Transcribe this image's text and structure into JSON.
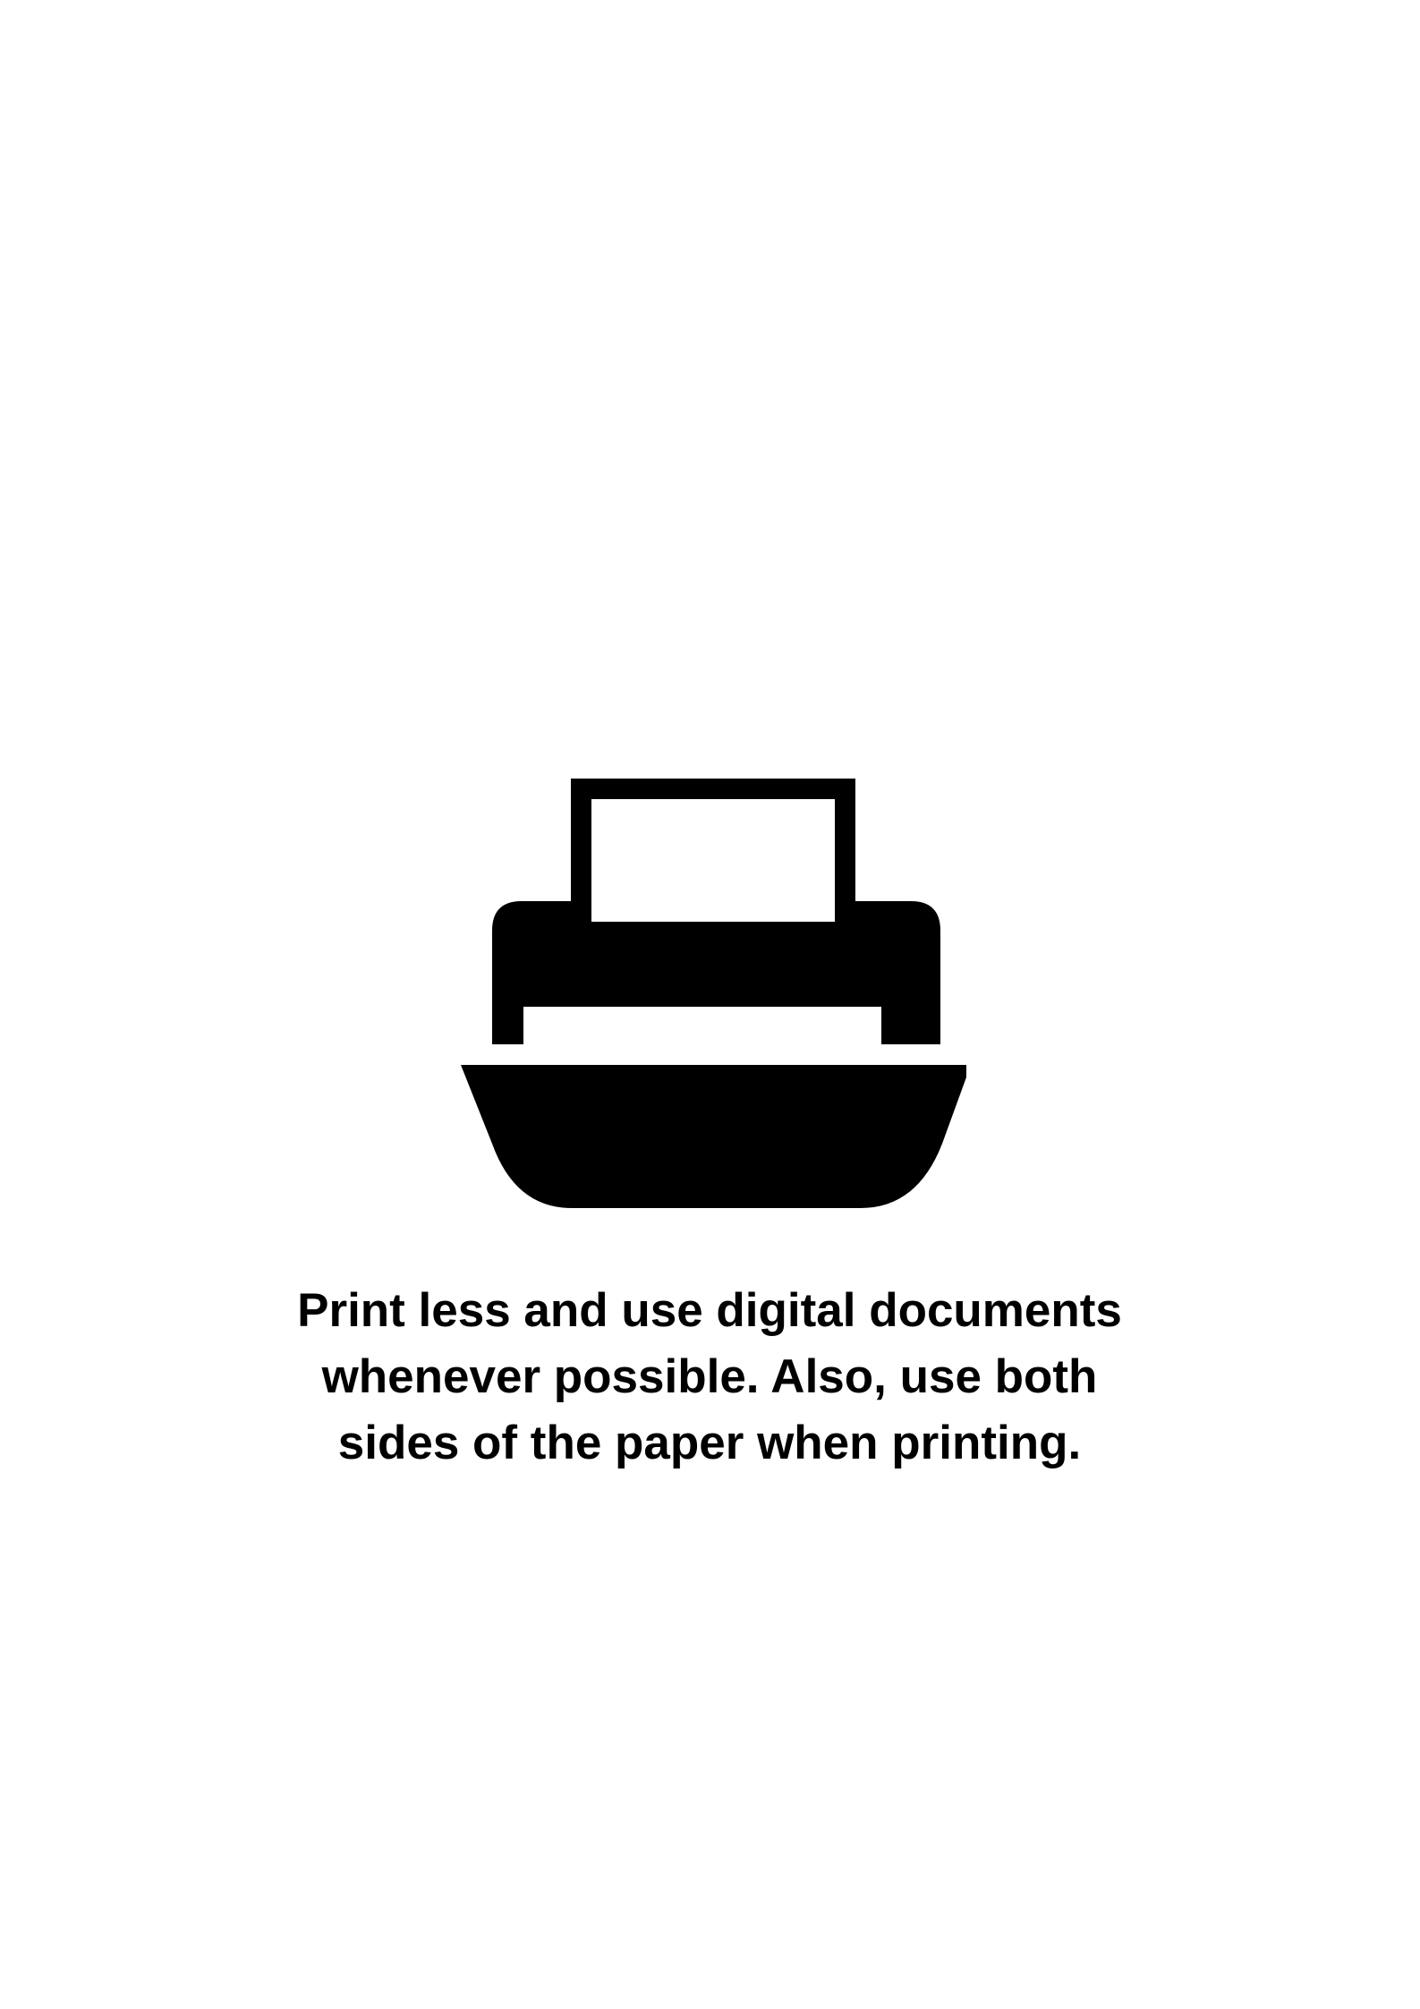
{
  "icon": {
    "name": "printer-icon",
    "color": "#000000"
  },
  "message": {
    "lines": [
      "Print less and use digital documents",
      "whenever possible. Also, use both",
      "sides of the paper when printing."
    ]
  },
  "colors": {
    "background": "#ffffff",
    "text": "#000000"
  }
}
